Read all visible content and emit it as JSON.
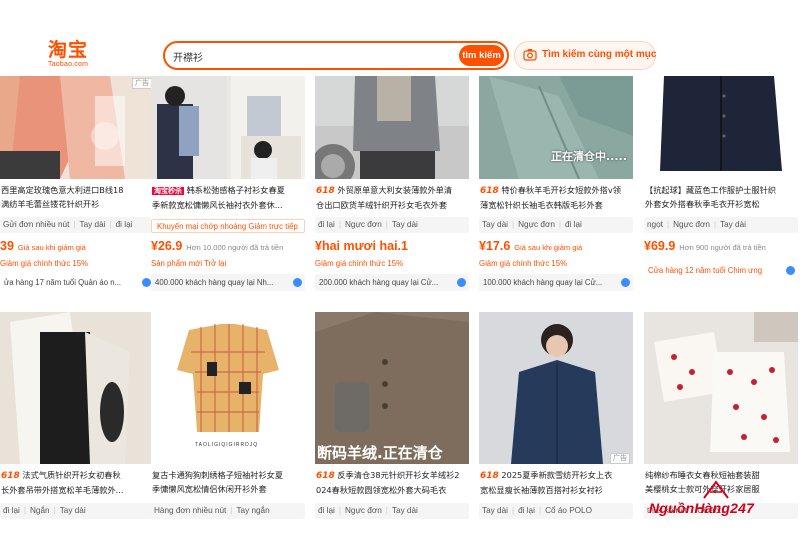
{
  "header": {
    "logo_cn": "淘宝",
    "logo_en": "Taobao.com",
    "search_value": "开襟衫",
    "search_button": "tìm kiếm",
    "image_search": "Tìm kiếm cùng một mục",
    "colors": {
      "accent": "#ff5000"
    }
  },
  "row1": [
    {
      "title_prefix": "",
      "title": "西里高定玫瑰色意大利进口B线18\n满纺羊毛蕾丝镂花针织开衫",
      "tags": [
        "Gửi đơn nhiều nút",
        "Tay dài",
        "đi lại"
      ],
      "price": "39",
      "price_note": "Giá sau khi giảm giá",
      "promo": "Giảm giá chính thức 15%",
      "shop": "ửa hàng 17 năm tuổi Quản áo n..."
    },
    {
      "title_prefix": "淘宝秒杀",
      "title": "韩系松弛感格子衬衫女春夏\n季新款宽松慵懒风长袖衬衣外套休...",
      "tags": [],
      "price": "¥26.9",
      "price_note": "Hơn 10.000 người đã trả tiền",
      "promo": "Khuyến mại chớp nhoáng Giảm trực tiếp",
      "promo2": "Sản phẩm mới  Trở lại",
      "shop": "400.000 khách hàng quay lại Nh..."
    },
    {
      "title_prefix": "618",
      "title": "外贸原单意大利女装薄款外单清\n仓出口欧货羊绒针织开衫女毛衣外套",
      "tags": [
        "đi lại",
        "Ngực đơn",
        "Tay dài"
      ],
      "price": "¥hai mươi hai.1",
      "price_note": "",
      "promo": "Giảm giá chính thức 15%",
      "shop": "200.000 khách hàng quay lại Cử..."
    },
    {
      "title_prefix": "618",
      "title": "特价春秋羊毛开衫女短款外搭v领\n薄宽松针织长袖毛衣韩版毛衫外套",
      "tags": [
        "Tay dài",
        "Ngực đơn",
        "đi lại"
      ],
      "price": "¥17.6",
      "price_note": "Giá sau khi giảm giá",
      "promo": "Giảm giá chính thức 15%",
      "shop": "100.000 khách hàng quay lại Cử...",
      "img_overlay": "正在清仓中....."
    },
    {
      "title_prefix": "",
      "title": "【抗起球】藏蓝色工作服护士服针织\n外套女外搭春秋季毛衣开衫宽松",
      "tags": [
        "ngọt",
        "Ngực đơn",
        "Tay dài"
      ],
      "price": "¥69.9",
      "price_note": "Hơn 900 người đã trả tiền",
      "promo": "",
      "shop": "Cửa hàng 12 năm tuổi Chim ưng"
    }
  ],
  "row2": [
    {
      "title_prefix": "618",
      "title": "法式气质针织开衫女初春秋\n长外套吊带外搭宽松羊毛薄款外...",
      "tags": [
        "đi lại",
        "Ngắn",
        "Tay dài"
      ]
    },
    {
      "title_prefix": "",
      "title": "复古卡通狗狗刺绣格子短袖衬衫女夏\n季慵懒风宽松情侣休闲开衫外套",
      "tags": [
        "Hàng đơn nhiều nút",
        "Tay ngắn"
      ],
      "img_caption": "TAOLIGIQIGIRRDJQ"
    },
    {
      "title_prefix": "618",
      "title": "反季清仓38元针织开衫女羊绒衫2\n024春秋短款圆领宽松外套大码毛衣",
      "tags": [
        "đi lại",
        "Ngực đơn",
        "Tay dài"
      ],
      "img_overlay": "断码羊绒.正在清仓"
    },
    {
      "title_prefix": "618",
      "title": "2025夏季新款雪纺开衫女上衣\n宽松显瘦长袖薄款百搭衬衫女衬衫",
      "tags": [
        "Tay dài",
        "đi lại",
        "Cổ áo POLO"
      ]
    },
    {
      "title_prefix": "",
      "title": "纯棉纱布睡衣女春秋短袖套装甜\n美樱桃女士款可外穿开衫家居服",
      "tags": [
        "thiết kế nút",
        "Cổ áo..."
      ]
    }
  ],
  "ad_label": "广告",
  "watermark": "NguồnHàng247"
}
